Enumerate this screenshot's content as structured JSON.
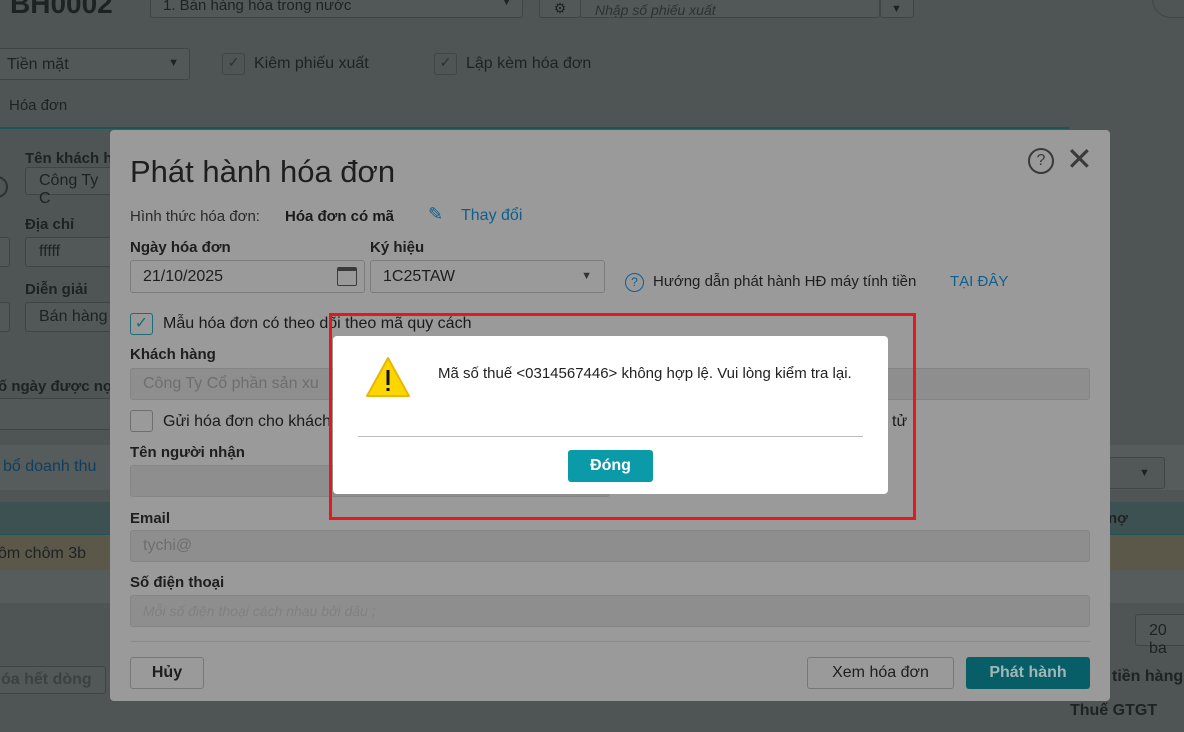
{
  "background": {
    "doc_code": "BH0002",
    "sale_type": "1. Bán hàng hóa trong nước",
    "search_placeholder": "Nhập số phiếu xuất",
    "payment": "Tiền mặt",
    "check_export": "Kiêm phiếu xuất",
    "check_invoice": "Lập kèm hóa đơn",
    "tab_invoice": "Hóa đơn",
    "customer_name_label": "Tên khách h",
    "customer_name_value": "Công Ty C",
    "address_label": "Địa chỉ",
    "address_value": "fffff",
    "description_label": "Diễn giải",
    "description_value": "Bán hàng",
    "debt_days_label": "ố ngày được nợ",
    "revenue_link": "bổ doanh thu",
    "row_item": "ôm chôm 3b",
    "col_debt": "nợ",
    "page_size": "20 ba",
    "delete_rows": "óa hết dòng",
    "total_goods": "tiền hàng",
    "vat": "Thuế GTGT"
  },
  "modal": {
    "title": "Phát hành hóa đơn",
    "invoice_type_label": "Hình thức hóa đơn:",
    "invoice_type_value": "Hóa đơn có mã",
    "change_link": "Thay đổi",
    "date_label": "Ngày hóa đơn",
    "date_value": "21/10/2025",
    "symbol_label": "Ký hiệu",
    "symbol_value": "1C25TAW",
    "guide_text": "Hướng dẫn phát hành HĐ máy tính tiền",
    "guide_link": "TẠI ĐÂY",
    "template_check": "Mẫu hóa đơn có theo dõi theo mã quy cách",
    "template_checked": true,
    "customer_label": "Khách hàng",
    "customer_value": "Công Ty Cổ phần sản xu",
    "send_check": "Gửi hóa đơn cho khách",
    "send_check_tail": "tử",
    "send_checked": false,
    "recipient_label": "Tên người nhận",
    "recipient_value": "",
    "email_label": "Email",
    "email_value": "tychi@",
    "phone_label": "Số điện thoại",
    "phone_placeholder": "Mỗi số điện thoại cách nhau bởi dấu ;",
    "cancel": "Hủy",
    "preview": "Xem hóa đơn",
    "issue": "Phát hành"
  },
  "alert": {
    "icon": "warning-icon",
    "message": "Mã số thuế <0314567446> không hợp lệ. Vui lòng kiểm tra lại.",
    "close": "Đóng"
  },
  "colors": {
    "accent": "#0b9aa8",
    "link": "#0e5f8f",
    "highlight": "#e3191e",
    "warning": "#fcd600"
  }
}
